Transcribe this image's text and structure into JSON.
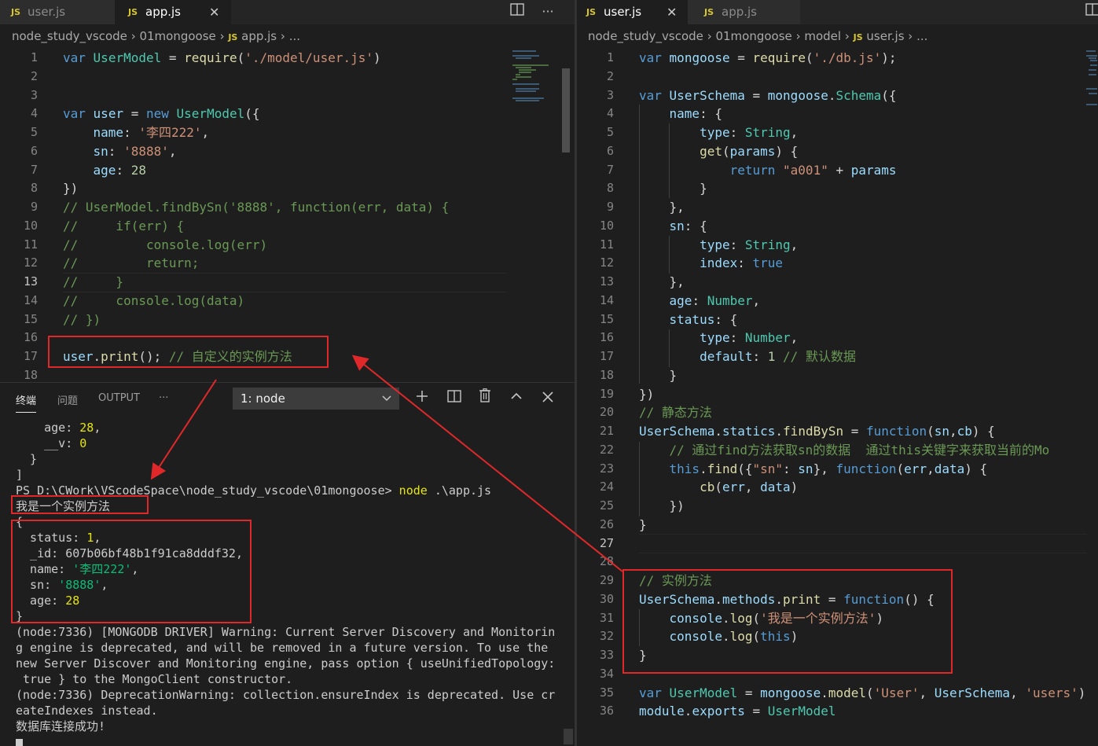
{
  "left_editor": {
    "tabs": [
      {
        "badge": "JS",
        "name": "user.js",
        "active": false
      },
      {
        "badge": "JS",
        "name": "app.js",
        "active": true,
        "close": "✕"
      }
    ],
    "actions": {
      "split": "split-editor-icon",
      "more": "···"
    },
    "breadcrumb": [
      "node_study_vscode",
      "01mongoose",
      "app.js",
      "..."
    ],
    "breadcrumb_badge": "JS",
    "current_line": "13",
    "lines": [
      {
        "n": "1",
        "tokens": [
          [
            "kw",
            "var"
          ],
          [
            "p",
            " "
          ],
          [
            "cls",
            "UserModel"
          ],
          [
            "p",
            " = "
          ],
          [
            "fn",
            "require"
          ],
          [
            "p",
            "("
          ],
          [
            "str",
            "'./model/user.js'"
          ],
          [
            "p",
            ")"
          ]
        ]
      },
      {
        "n": "2",
        "tokens": []
      },
      {
        "n": "3",
        "tokens": []
      },
      {
        "n": "4",
        "tokens": [
          [
            "kw",
            "var"
          ],
          [
            "p",
            " "
          ],
          [
            "var",
            "user"
          ],
          [
            "p",
            " = "
          ],
          [
            "kw",
            "new"
          ],
          [
            "p",
            " "
          ],
          [
            "cls",
            "UserModel"
          ],
          [
            "p",
            "({"
          ]
        ]
      },
      {
        "n": "5",
        "tokens": [
          [
            "p",
            "    "
          ],
          [
            "var",
            "name"
          ],
          [
            "p",
            ": "
          ],
          [
            "str",
            "'李四222'"
          ],
          [
            "p",
            ","
          ]
        ]
      },
      {
        "n": "6",
        "tokens": [
          [
            "p",
            "    "
          ],
          [
            "var",
            "sn"
          ],
          [
            "p",
            ": "
          ],
          [
            "str",
            "'8888'"
          ],
          [
            "p",
            ","
          ]
        ]
      },
      {
        "n": "7",
        "tokens": [
          [
            "p",
            "    "
          ],
          [
            "var",
            "age"
          ],
          [
            "p",
            ": "
          ],
          [
            "num",
            "28"
          ]
        ]
      },
      {
        "n": "8",
        "tokens": [
          [
            "p",
            "})"
          ]
        ]
      },
      {
        "n": "9",
        "tokens": [
          [
            "com",
            "// UserModel.findBySn('8888', function(err, data) {"
          ]
        ]
      },
      {
        "n": "10",
        "tokens": [
          [
            "com",
            "//     if(err) {"
          ]
        ]
      },
      {
        "n": "11",
        "tokens": [
          [
            "com",
            "//         console.log(err)"
          ]
        ]
      },
      {
        "n": "12",
        "tokens": [
          [
            "com",
            "//         return;"
          ]
        ]
      },
      {
        "n": "13",
        "tokens": [
          [
            "com",
            "//     }"
          ]
        ]
      },
      {
        "n": "14",
        "tokens": [
          [
            "com",
            "//     console.log(data)"
          ]
        ]
      },
      {
        "n": "15",
        "tokens": [
          [
            "com",
            "// })"
          ]
        ]
      },
      {
        "n": "16",
        "tokens": []
      },
      {
        "n": "17",
        "tokens": [
          [
            "var",
            "user"
          ],
          [
            "p",
            "."
          ],
          [
            "fn",
            "print"
          ],
          [
            "p",
            "(); "
          ],
          [
            "com",
            "// 自定义的实例方法"
          ]
        ]
      },
      {
        "n": "18",
        "tokens": []
      }
    ]
  },
  "panel": {
    "tabs": [
      "终端",
      "问题",
      "OUTPUT",
      "···"
    ],
    "selected_terminal": "1: node",
    "icons": [
      "add-terminal-icon",
      "split-terminal-icon",
      "trash-icon",
      "maximize-panel-icon",
      "close-panel-icon"
    ],
    "lines": [
      [
        [
          "p",
          "    age: "
        ],
        [
          "y",
          "28"
        ],
        [
          "p",
          ","
        ]
      ],
      [
        [
          "p",
          "    __v: "
        ],
        [
          "y",
          "0"
        ]
      ],
      [
        [
          "p",
          "  }"
        ]
      ],
      [
        [
          "p",
          "]"
        ]
      ],
      [
        [
          "p",
          "PS D:\\CWork\\VScodeSpace\\node_study_vscode\\01mongoose> "
        ],
        [
          "y",
          "node"
        ],
        [
          "p",
          " .\\app.js"
        ]
      ],
      [
        [
          "p",
          "我是一个实例方法"
        ]
      ],
      [
        [
          "p",
          "{"
        ]
      ],
      [
        [
          "p",
          "  status: "
        ],
        [
          "y",
          "1"
        ],
        [
          "p",
          ","
        ]
      ],
      [
        [
          "p",
          "  _id: 607b06bf48b1f91ca8dddf32,"
        ]
      ],
      [
        [
          "p",
          "  name: "
        ],
        [
          "g",
          "'李四222'"
        ],
        [
          "p",
          ","
        ]
      ],
      [
        [
          "p",
          "  sn: "
        ],
        [
          "g",
          "'8888'"
        ],
        [
          "p",
          ","
        ]
      ],
      [
        [
          "p",
          "  age: "
        ],
        [
          "y",
          "28"
        ]
      ],
      [
        [
          "p",
          "}"
        ]
      ],
      [
        [
          "p",
          "(node:7336) [MONGODB DRIVER] Warning: Current Server Discovery and Monitorin"
        ]
      ],
      [
        [
          "p",
          "g engine is deprecated, and will be removed in a future version. To use the"
        ]
      ],
      [
        [
          "p",
          "new Server Discover and Monitoring engine, pass option { useUnifiedTopology:"
        ]
      ],
      [
        [
          "p",
          " true } to the MongoClient constructor."
        ]
      ],
      [
        [
          "p",
          "(node:7336) DeprecationWarning: collection.ensureIndex is deprecated. Use cr"
        ]
      ],
      [
        [
          "p",
          "eateIndexes instead."
        ]
      ],
      [
        [
          "p",
          "数据库连接成功!"
        ]
      ]
    ]
  },
  "right_editor": {
    "tabs": [
      {
        "badge": "JS",
        "name": "user.js",
        "active": true,
        "close": "✕"
      },
      {
        "badge": "JS",
        "name": "app.js",
        "active": false
      }
    ],
    "breadcrumb": [
      "node_study_vscode",
      "01mongoose",
      "model",
      "user.js",
      "..."
    ],
    "breadcrumb_badge": "JS",
    "current_line": "27",
    "lines": [
      {
        "n": "1",
        "tokens": [
          [
            "kw",
            "var"
          ],
          [
            "p",
            " "
          ],
          [
            "var",
            "mongoose"
          ],
          [
            "p",
            " = "
          ],
          [
            "fn",
            "require"
          ],
          [
            "p",
            "("
          ],
          [
            "str",
            "'./db.js'"
          ],
          [
            "p",
            ");"
          ]
        ]
      },
      {
        "n": "2",
        "tokens": []
      },
      {
        "n": "3",
        "tokens": [
          [
            "kw",
            "var"
          ],
          [
            "p",
            " "
          ],
          [
            "var",
            "UserSchema"
          ],
          [
            "p",
            " = "
          ],
          [
            "var",
            "mongoose"
          ],
          [
            "p",
            "."
          ],
          [
            "cls",
            "Schema"
          ],
          [
            "p",
            "({"
          ]
        ]
      },
      {
        "n": "4",
        "tokens": [
          [
            "p",
            "    "
          ],
          [
            "var",
            "name"
          ],
          [
            "p",
            ": {"
          ]
        ]
      },
      {
        "n": "5",
        "tokens": [
          [
            "p",
            "        "
          ],
          [
            "var",
            "type"
          ],
          [
            "p",
            ": "
          ],
          [
            "cls",
            "String"
          ],
          [
            "p",
            ","
          ]
        ]
      },
      {
        "n": "6",
        "tokens": [
          [
            "p",
            "        "
          ],
          [
            "fn",
            "get"
          ],
          [
            "p",
            "("
          ],
          [
            "var",
            "params"
          ],
          [
            "p",
            ") {"
          ]
        ]
      },
      {
        "n": "7",
        "tokens": [
          [
            "p",
            "            "
          ],
          [
            "kw",
            "return"
          ],
          [
            "p",
            " "
          ],
          [
            "str",
            "\"a001\""
          ],
          [
            "p",
            " + "
          ],
          [
            "var",
            "params"
          ]
        ]
      },
      {
        "n": "8",
        "tokens": [
          [
            "p",
            "        }"
          ]
        ]
      },
      {
        "n": "9",
        "tokens": [
          [
            "p",
            "    },"
          ]
        ]
      },
      {
        "n": "10",
        "tokens": [
          [
            "p",
            "    "
          ],
          [
            "var",
            "sn"
          ],
          [
            "p",
            ": {"
          ]
        ]
      },
      {
        "n": "11",
        "tokens": [
          [
            "p",
            "        "
          ],
          [
            "var",
            "type"
          ],
          [
            "p",
            ": "
          ],
          [
            "cls",
            "String"
          ],
          [
            "p",
            ","
          ]
        ]
      },
      {
        "n": "12",
        "tokens": [
          [
            "p",
            "        "
          ],
          [
            "var",
            "index"
          ],
          [
            "p",
            ": "
          ],
          [
            "kw",
            "true"
          ]
        ]
      },
      {
        "n": "13",
        "tokens": [
          [
            "p",
            "    },"
          ]
        ]
      },
      {
        "n": "14",
        "tokens": [
          [
            "p",
            "    "
          ],
          [
            "var",
            "age"
          ],
          [
            "p",
            ": "
          ],
          [
            "cls",
            "Number"
          ],
          [
            "p",
            ","
          ]
        ]
      },
      {
        "n": "15",
        "tokens": [
          [
            "p",
            "    "
          ],
          [
            "var",
            "status"
          ],
          [
            "p",
            ": {"
          ]
        ]
      },
      {
        "n": "16",
        "tokens": [
          [
            "p",
            "        "
          ],
          [
            "var",
            "type"
          ],
          [
            "p",
            ": "
          ],
          [
            "cls",
            "Number"
          ],
          [
            "p",
            ","
          ]
        ]
      },
      {
        "n": "17",
        "tokens": [
          [
            "p",
            "        "
          ],
          [
            "var",
            "default"
          ],
          [
            "p",
            ": "
          ],
          [
            "num",
            "1"
          ],
          [
            "p",
            " "
          ],
          [
            "com",
            "// 默认数据"
          ]
        ]
      },
      {
        "n": "18",
        "tokens": [
          [
            "p",
            "    }"
          ]
        ]
      },
      {
        "n": "19",
        "tokens": [
          [
            "p",
            "})"
          ]
        ]
      },
      {
        "n": "20",
        "tokens": [
          [
            "com",
            "// 静态方法"
          ]
        ]
      },
      {
        "n": "21",
        "tokens": [
          [
            "var",
            "UserSchema"
          ],
          [
            "p",
            "."
          ],
          [
            "var",
            "statics"
          ],
          [
            "p",
            "."
          ],
          [
            "fn",
            "findBySn"
          ],
          [
            "p",
            " = "
          ],
          [
            "kw",
            "function"
          ],
          [
            "p",
            "("
          ],
          [
            "var",
            "sn"
          ],
          [
            "p",
            ","
          ],
          [
            "var",
            "cb"
          ],
          [
            "p",
            ") {"
          ]
        ]
      },
      {
        "n": "22",
        "tokens": [
          [
            "p",
            "    "
          ],
          [
            "com",
            "// 通过find方法获取sn的数据  通过this关键字来获取当前的Mo"
          ]
        ]
      },
      {
        "n": "23",
        "tokens": [
          [
            "p",
            "    "
          ],
          [
            "kw",
            "this"
          ],
          [
            "p",
            "."
          ],
          [
            "fn",
            "find"
          ],
          [
            "p",
            "({"
          ],
          [
            "str",
            "\"sn\""
          ],
          [
            "p",
            ": "
          ],
          [
            "var",
            "sn"
          ],
          [
            "p",
            "}, "
          ],
          [
            "kw",
            "function"
          ],
          [
            "p",
            "("
          ],
          [
            "var",
            "err"
          ],
          [
            "p",
            ","
          ],
          [
            "var",
            "data"
          ],
          [
            "p",
            ") {"
          ]
        ]
      },
      {
        "n": "24",
        "tokens": [
          [
            "p",
            "        "
          ],
          [
            "fn",
            "cb"
          ],
          [
            "p",
            "("
          ],
          [
            "var",
            "err"
          ],
          [
            "p",
            ", "
          ],
          [
            "var",
            "data"
          ],
          [
            "p",
            ")"
          ]
        ]
      },
      {
        "n": "25",
        "tokens": [
          [
            "p",
            "    })"
          ]
        ]
      },
      {
        "n": "26",
        "tokens": [
          [
            "p",
            "}"
          ]
        ]
      },
      {
        "n": "27",
        "tokens": []
      },
      {
        "n": "28",
        "tokens": []
      },
      {
        "n": "29",
        "tokens": [
          [
            "com",
            "// 实例方法"
          ]
        ]
      },
      {
        "n": "30",
        "tokens": [
          [
            "var",
            "UserSchema"
          ],
          [
            "p",
            "."
          ],
          [
            "var",
            "methods"
          ],
          [
            "p",
            "."
          ],
          [
            "fn",
            "print"
          ],
          [
            "p",
            " = "
          ],
          [
            "kw",
            "function"
          ],
          [
            "p",
            "() {"
          ]
        ]
      },
      {
        "n": "31",
        "tokens": [
          [
            "p",
            "    "
          ],
          [
            "var",
            "console"
          ],
          [
            "p",
            "."
          ],
          [
            "fn",
            "log"
          ],
          [
            "p",
            "("
          ],
          [
            "str",
            "'我是一个实例方法'"
          ],
          [
            "p",
            ")"
          ]
        ]
      },
      {
        "n": "32",
        "tokens": [
          [
            "p",
            "    "
          ],
          [
            "var",
            "console"
          ],
          [
            "p",
            "."
          ],
          [
            "fn",
            "log"
          ],
          [
            "p",
            "("
          ],
          [
            "kw",
            "this"
          ],
          [
            "p",
            ")"
          ]
        ]
      },
      {
        "n": "33",
        "tokens": [
          [
            "p",
            "}"
          ]
        ]
      },
      {
        "n": "34",
        "tokens": []
      },
      {
        "n": "35",
        "tokens": [
          [
            "kw",
            "var"
          ],
          [
            "p",
            " "
          ],
          [
            "cls",
            "UserModel"
          ],
          [
            "p",
            " = "
          ],
          [
            "var",
            "mongoose"
          ],
          [
            "p",
            "."
          ],
          [
            "fn",
            "model"
          ],
          [
            "p",
            "("
          ],
          [
            "str",
            "'User'"
          ],
          [
            "p",
            ", "
          ],
          [
            "var",
            "UserSchema"
          ],
          [
            "p",
            ", "
          ],
          [
            "str",
            "'users'"
          ],
          [
            "p",
            ")"
          ]
        ]
      },
      {
        "n": "36",
        "tokens": [
          [
            "var",
            "module"
          ],
          [
            "p",
            "."
          ],
          [
            "var",
            "exports"
          ],
          [
            "p",
            " = "
          ],
          [
            "cls",
            "UserModel"
          ]
        ]
      }
    ]
  },
  "colors": {
    "annotation": "#e0282a",
    "background": "#1e1e1e"
  }
}
